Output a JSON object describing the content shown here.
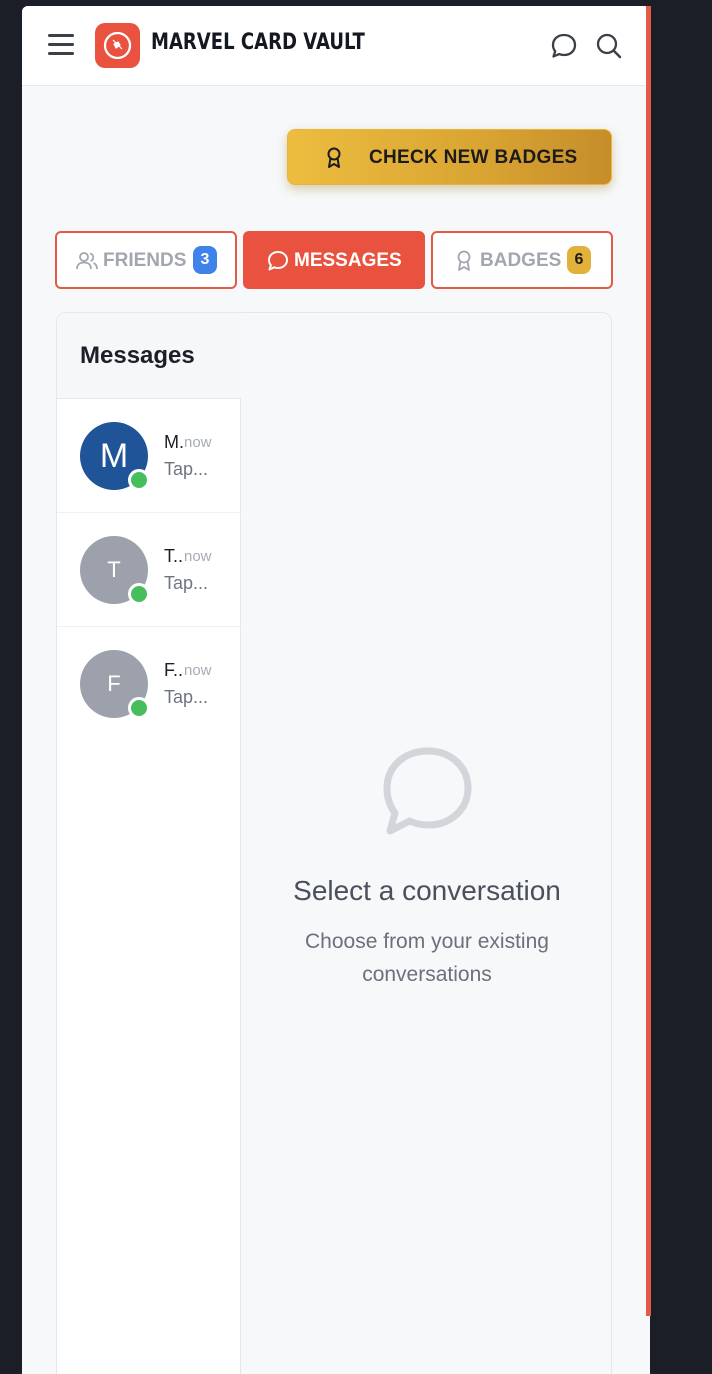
{
  "header": {
    "brand": "MARVEL CARD VAULT",
    "menu_icon": "hamburger-menu-icon",
    "logo_icon": "shield-logo-icon",
    "chat_icon": "chat-bubble-icon",
    "search_icon": "search-icon"
  },
  "actions": {
    "check_badges_label": "CHECK NEW BADGES",
    "check_badges_icon": "award-ribbon-icon"
  },
  "tabs": [
    {
      "label": "FRIENDS",
      "count": "3",
      "icon": "users-icon",
      "active": false
    },
    {
      "label": "MESSAGES",
      "icon": "chat-bubble-icon",
      "active": true
    },
    {
      "label": "BADGES",
      "count": "6",
      "icon": "award-icon",
      "active": false
    }
  ],
  "messages": {
    "title": "Messages",
    "conversations": [
      {
        "initial": "M",
        "name": "M.",
        "time": "now",
        "preview": "Tap...",
        "avatar_color": "#1f5499",
        "online": true
      },
      {
        "initial": "T",
        "name": "T..",
        "time": "now",
        "preview": "Tap...",
        "avatar_color": "#9ca1ab",
        "online": true
      },
      {
        "initial": "F",
        "name": "F..",
        "time": "now",
        "preview": "Tap...",
        "avatar_color": "#9ca1ab",
        "online": true
      }
    ]
  },
  "empty_state": {
    "icon": "chat-bubble-icon",
    "title": "Select a conversation",
    "subtitle": "Choose from your existing conversations"
  },
  "colors": {
    "accent": "#e8523f",
    "badge_gold": "#e2b13a",
    "friends_count_bg": "#3f82ea",
    "online": "#46be5c"
  }
}
